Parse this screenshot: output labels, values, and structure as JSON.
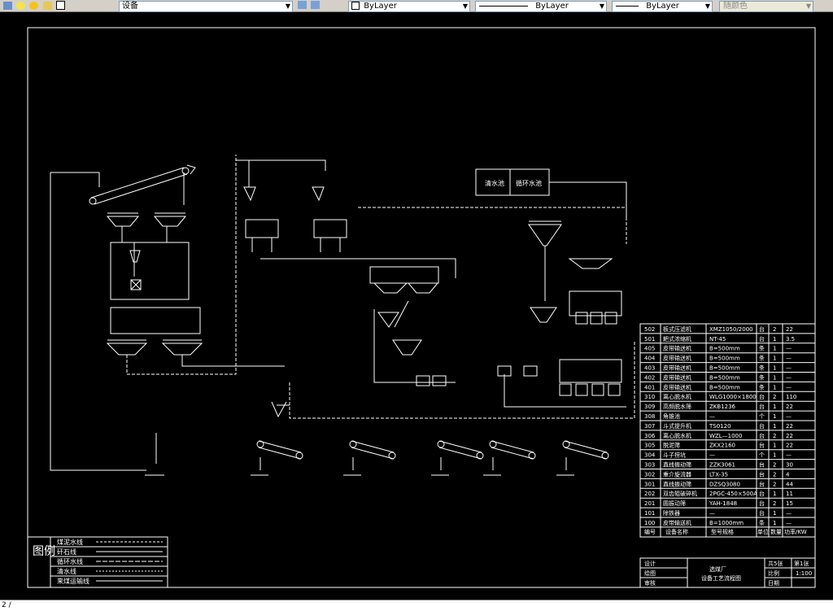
{
  "toolbar": {
    "layer_name": "设备",
    "color": "ByLayer",
    "linetype": "ByLayer",
    "lineweight": "ByLayer",
    "plotstyle": "随颜色"
  },
  "drawing": {
    "equipment_table": {
      "rows": [
        [
          "502",
          "板式压滤机",
          "XMZ1050/2000",
          "台",
          "2",
          "22"
        ],
        [
          "501",
          "耙式浓缩机",
          "NT-45",
          "台",
          "1",
          "3.5"
        ],
        [
          "405",
          "皮带输送机",
          "B=500mm",
          "条",
          "1",
          "—"
        ],
        [
          "404",
          "皮带输送机",
          "B=500mm",
          "条",
          "1",
          "—"
        ],
        [
          "403",
          "皮带输送机",
          "B=500mm",
          "条",
          "1",
          "—"
        ],
        [
          "402",
          "皮带输送机",
          "B=500mm",
          "条",
          "1",
          "—"
        ],
        [
          "401",
          "皮带输送机",
          "B=500mm",
          "条",
          "1",
          "—"
        ],
        [
          "310",
          "离心脱水机",
          "WLG1000×1800",
          "台",
          "2",
          "110"
        ],
        [
          "309",
          "高频脱水筛",
          "ZKB1236",
          "台",
          "1",
          "22"
        ],
        [
          "308",
          "角锥池",
          "—",
          "个",
          "1",
          "—"
        ],
        [
          "307",
          "斗式提升机",
          "TS0120",
          "台",
          "1",
          "22"
        ],
        [
          "306",
          "离心脱水机",
          "WZL—1000",
          "台",
          "2",
          "22"
        ],
        [
          "305",
          "脱泥筛",
          "ZKX2160",
          "台",
          "1",
          "22"
        ],
        [
          "304",
          "斗子捞坑",
          "—",
          "个",
          "1",
          "—"
        ],
        [
          "303",
          "直线振动筛",
          "ZZK3061",
          "台",
          "2",
          "30"
        ],
        [
          "302",
          "重介旋流器",
          "LTX-35",
          "台",
          "2",
          "4"
        ],
        [
          "301",
          "直线振动筛",
          "DZSQ3080",
          "台",
          "2",
          "44"
        ],
        [
          "202",
          "双齿辊破碎机",
          "2PGC-450×500A",
          "台",
          "1",
          "11"
        ],
        [
          "201",
          "圆振动筛",
          "YAH-1848",
          "台",
          "2",
          "15"
        ],
        [
          "101",
          "除铁器",
          "—",
          "台",
          "1",
          "—"
        ],
        [
          "100",
          "皮带输送机",
          "B=1000mm",
          "条",
          "1",
          "—"
        ]
      ],
      "header": [
        "编号",
        "设备名称",
        "型号规格",
        "单位",
        "数量",
        "功率/KW"
      ]
    },
    "title_block": {
      "design": "设计",
      "drawing": "绘图",
      "check": "审核",
      "title_line1": "选煤厂",
      "title_line2": "设备工艺流程图",
      "sheet_total": "共5张",
      "sheet_no": "第1张",
      "scale_label": "比例",
      "scale": "1:100",
      "date_label": "日期"
    },
    "legend": {
      "title": "图例",
      "items": [
        "煤泥水线",
        "矸石线",
        "循环水线",
        "清水线",
        "来煤运输线"
      ]
    },
    "tank_labels": [
      "清水池",
      "循环水池"
    ]
  },
  "cmdline": {
    "text": "2 /"
  }
}
